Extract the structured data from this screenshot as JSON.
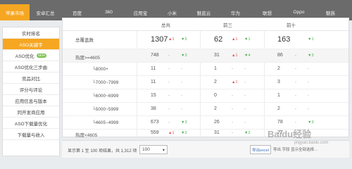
{
  "nav": {
    "tabs": [
      "苹果市场",
      "安卓汇总",
      "百度",
      "360",
      "应用宝",
      "小米",
      "魅蓝云",
      "华为",
      "联想",
      "Oppo",
      "魅族"
    ]
  },
  "sidebar": {
    "items": [
      {
        "label": "实时排名"
      },
      {
        "label": "ASO关键字"
      },
      {
        "label": "ASO优化",
        "badge": "NEW"
      },
      {
        "label": "ASO优化三步曲"
      },
      {
        "label": "竞品对比"
      },
      {
        "label": "评分与评论"
      },
      {
        "label": "应用信息与版本"
      },
      {
        "label": "同开发商应用"
      },
      {
        "label": "ASO下载量优化"
      },
      {
        "label": "下载量与收入"
      }
    ]
  },
  "table": {
    "headers": [
      "总共",
      "前三",
      "前十"
    ],
    "rows": [
      {
        "label": "总覆盖数",
        "c1": "1307",
        "c1u": "▲1",
        "c1d": "▼5",
        "c2": "62",
        "c2u": "▲1",
        "c2d": "▼1",
        "c3": "163",
        "c3u": "",
        "c3d": "▼1"
      },
      {
        "label": "热度>=4605",
        "c1": "748",
        "c1u": "-",
        "c1d": "▼3",
        "c2": "31",
        "c2u": "▲1",
        "c2d": "▼4",
        "c3": "86",
        "c3u": "-",
        "c3d": "▼3"
      },
      {
        "label": "└8000+",
        "c1": "11",
        "c1u": "-",
        "c1d": "-",
        "c2": "1",
        "c2u": "-",
        "c2d": "-",
        "c3": "2",
        "c3u": "-",
        "c3d": "-"
      },
      {
        "label": "└7000~7999",
        "c1": "11",
        "c1u": "-",
        "c1d": "-",
        "c2": "2",
        "c2u": "▲1",
        "c2d": "-",
        "c3": "3",
        "c3u": "-",
        "c3d": "-"
      },
      {
        "label": "└6000~6999",
        "c1": "15",
        "c1u": "-",
        "c1d": "-",
        "c2": "0",
        "c2u": "-",
        "c2d": "-",
        "c3": "1",
        "c3u": "-",
        "c3d": "-"
      },
      {
        "label": "└5000~5999",
        "c1": "38",
        "c1u": "-",
        "c1d": "-",
        "c2": "2",
        "c2u": "-",
        "c2d": "-",
        "c3": "2",
        "c3u": "-",
        "c3d": "-"
      },
      {
        "label": "└4605~4999",
        "c1": "673",
        "c1u": "-",
        "c1d": "▼3",
        "c2": "26",
        "c2u": "-",
        "c2d": "-",
        "c3": "78",
        "c3u": "-",
        "c3d": "▼3"
      },
      {
        "label": "热度<4605",
        "c1": "559",
        "c1u": "▲1",
        "c1d": "▼2",
        "c2": "31",
        "c2u": "-",
        "c2d": "▼2",
        "c3": "77",
        "c3u": "-",
        "c3d": "-"
      }
    ]
  },
  "footer": {
    "pager": "显示第 1 至 100 项结果，共 1,312 项",
    "page_size": "100",
    "export": "导出excel",
    "note": "导出 字段 显示全部选择..."
  },
  "watermark": {
    "main": "Baidu经验",
    "sub": "jingyan.baidu.com"
  },
  "colors": {
    "accent": "#f6a621",
    "nav_bg": "#6b6b6b",
    "up": "#d9534f",
    "down": "#4caf50"
  }
}
